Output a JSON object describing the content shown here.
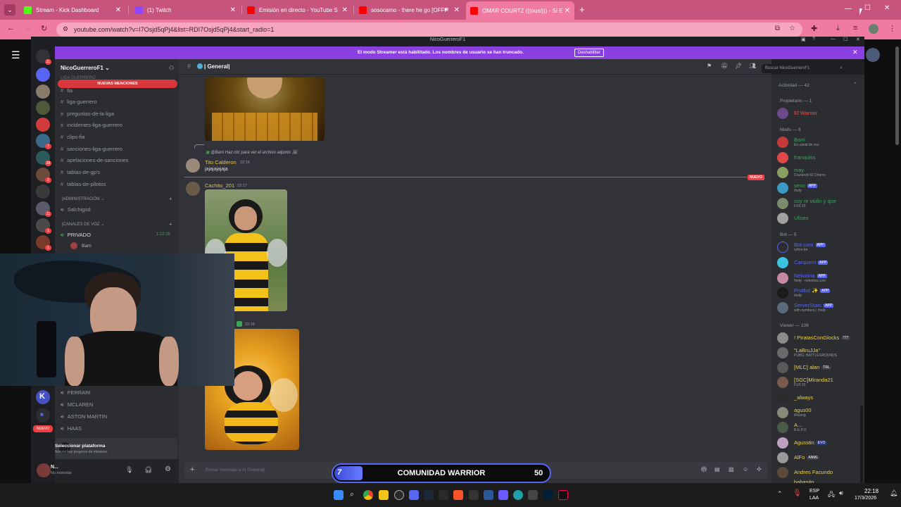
{
  "browser": {
    "tabs": [
      {
        "title": "Stream - Kick Dashboard",
        "color": "#53fc18"
      },
      {
        "title": "(1) Twitch",
        "color": "#9146ff"
      },
      {
        "title": "Emisión en directo - YouTube S",
        "color": "#ff0000"
      },
      {
        "title": "sosocamo - there he go [OFFI",
        "color": "#ff0000"
      },
      {
        "title": "OMAR COURTZ (((ousi))) - Sí E",
        "color": "#ff0000"
      }
    ],
    "url": "youtube.com/watch?v=I7Osjd5qPj4&list=RDI7Osjd5qPj4&start_radio=1"
  },
  "discord": {
    "window_title": "NicoGuerreroF1",
    "streamer_notice": "El modo Streamer está habilitado. Los nombres de usuario se han truncado.",
    "streamer_disable": "Deshabilitar",
    "server_name": "NicoGuerreroF1",
    "category_top": "LIGA GUERRERO",
    "new_mentions": "NUEVAS MENCIONES",
    "channels": [
      "fia",
      "liga-guerrero",
      "preguntas-de-la-liga",
      "incidentes-liga-guerrero",
      "clips-fia",
      "sanciones-liga-guerrero",
      "apelaciones-de-sanciones",
      "tablas-de-gp's",
      "tablas-de-pilotos"
    ],
    "admin_category": "|ADMINISTRACIÓN",
    "admin_channel": "Salchigod",
    "voice_category": "|CANALES DE VOZ",
    "voice_private": "PRIVADO",
    "voice_private_time": "1:22:35",
    "voice_private_user": "Barri",
    "voice_channels": [
      "FERRARI",
      "MCLAREN",
      "ASTON MARTIN",
      "HAAS"
    ],
    "platform_title": "Seleccionar plataforma",
    "platform_sub": "Aún no hay progreso de misiones",
    "user_name": "N...",
    "user_status": "No molestar",
    "channel_header": "| General|",
    "search_placeholder": "Buscar NicoGuerreroF1",
    "messages": [
      {
        "reply": "@Barri Haz clic para ver el archivo adjunto",
        "author": "Tito Calderon",
        "time": "22:16",
        "text": "jajajajajaja"
      },
      {
        "author": "Cachito_201",
        "time": "22:17"
      },
      {
        "time": "22:18"
      }
    ],
    "new_label": "NUEVO",
    "composer_placeholder": "Enviar mensaje a #| General|",
    "members": {
      "activity": "Actividad — 42",
      "owner_section": "Propietario — 1",
      "owner": "El Warrior",
      "mods_section": "Mods — 6",
      "mods": [
        {
          "name": "Barri",
          "sub": "En canal de voz",
          "color": "#3ba55d"
        },
        {
          "name": "franquiss",
          "sub": "",
          "color": "#3ba55d"
        },
        {
          "name": "may",
          "sub": "Cruzando El Charco",
          "color": "#3ba55d"
        },
        {
          "name": "sexo",
          "sub": "/help",
          "color": "#3ba55d",
          "tag": "APP"
        },
        {
          "name": "soy re violin y que",
          "sub": "F1® 25",
          "color": "#3ba55d"
        },
        {
          "name": "Ulises",
          "sub": "",
          "color": "#3ba55d"
        }
      ],
      "bot_section": "Bot — 5",
      "bots": [
        {
          "name": "Bot.com",
          "sub": "rythm.fm",
          "color": "#5865f2"
        },
        {
          "name": "Carquero",
          "sub": "",
          "color": "#5865f2"
        },
        {
          "name": "Nekotina",
          "sub": "!help · nekotina.com",
          "color": "#5865f2"
        },
        {
          "name": "ProBot ✨",
          "sub": "/help",
          "color": "#5865f2"
        },
        {
          "name": "ServerStats",
          "sub": "with numbers | /help",
          "color": "#5865f2"
        }
      ],
      "viewer_section": "Viewer — 108",
      "viewers": [
        {
          "name": "! PiratasConGlocks",
          "sub": "",
          "tag": "777"
        },
        {
          "name": "\"LaBruJJa\"",
          "sub": "PUBG: BATTLEGROUNDS"
        },
        {
          "name": "[MLC] alan",
          "sub": "",
          "tag": "TRL"
        },
        {
          "name": "[SGC]Miranda21",
          "sub": "F1® 25"
        },
        {
          "name": "_always",
          "sub": ""
        },
        {
          "name": "agus00",
          "sub": "iRacing"
        },
        {
          "name": "A...",
          "sub": "R.E.P.O"
        },
        {
          "name": "Agusstin",
          "sub": "",
          "tag": "EVO"
        },
        {
          "name": "AlFo",
          "sub": "",
          "tag": "ANML"
        },
        {
          "name": "Andres Facundo",
          "sub": ""
        },
        {
          "name": "babasito",
          "sub": ""
        }
      ]
    }
  },
  "overlay": {
    "left_number": "7",
    "title": "COMUNIDAD WARRIOR",
    "right_number": "50"
  },
  "taskbar": {
    "lang": "ESP",
    "lang_sub": "LAA",
    "time": "22:18",
    "date": "17/3/2026"
  }
}
